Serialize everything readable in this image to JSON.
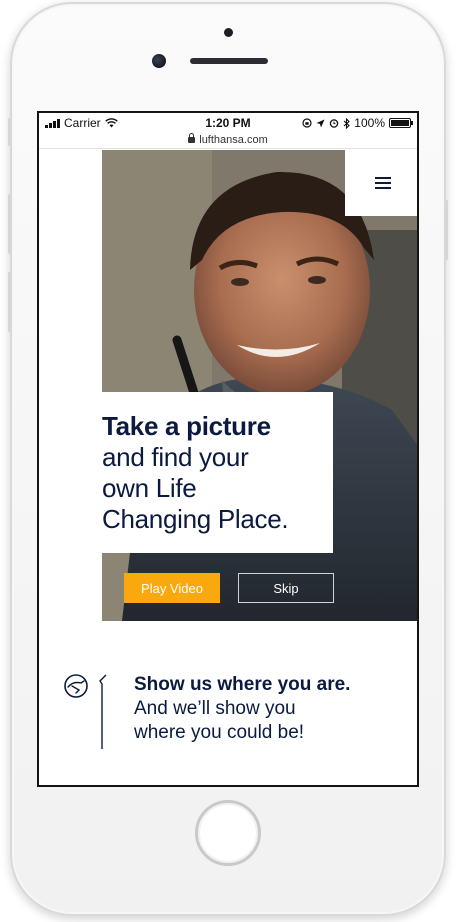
{
  "status_bar": {
    "carrier": "Carrier",
    "time": "1:20 PM",
    "battery": "100%"
  },
  "browser": {
    "url": "lufthansa.com"
  },
  "hero": {
    "headline_bold": "Take a picture",
    "headline_line_1": "and find your",
    "headline_line_2": "own Life",
    "headline_line_3": "Changing Place.",
    "play_label": "Play Video",
    "skip_label": "Skip"
  },
  "section": {
    "title": "Show us where you are.",
    "subtitle_line_1": "And we’ll show you",
    "subtitle_line_2": "where you could be!"
  },
  "icons": {
    "menu": "hamburger-menu-icon",
    "logo": "lufthansa-crane-icon",
    "lock": "lock-icon"
  },
  "colors": {
    "navy": "#0b1a3e",
    "accent_yellow": "#f9a80e"
  }
}
